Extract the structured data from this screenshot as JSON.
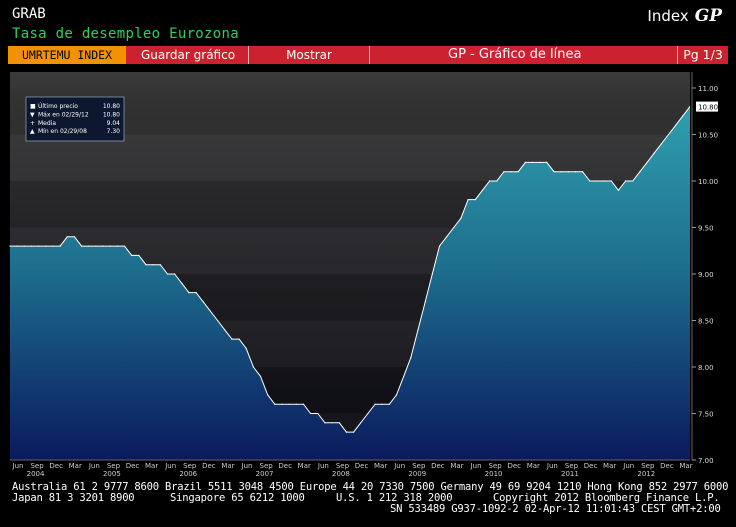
{
  "header": {
    "ticker_short": "GRAB",
    "title": "Tasa de desempleo Eurozona",
    "index_label": "Index",
    "function_code": "GP"
  },
  "menubar": {
    "ticker": "UMRTEMU INDEX",
    "save_label": "Guardar gráfico",
    "show_label": "Mostrar",
    "chart_title": "GP - Gráfico de línea",
    "page": "Pg 1/3"
  },
  "legend": {
    "rows": [
      {
        "label": "Último precio",
        "value": "10.80"
      },
      {
        "label": "Máx en 02/29/12",
        "value": "10.80"
      },
      {
        "label": "Media",
        "value": "9.04"
      },
      {
        "label": "Mín en 02/29/08",
        "value": "7.30"
      }
    ]
  },
  "last_price_tag": "10.80",
  "colors": {
    "accent_orange": "#f29200",
    "menubar_red": "#cc2230",
    "subtitle_green": "#2fd05a",
    "area_teal": "#2a8ea0",
    "area_navy": "#0a1a5e"
  },
  "chart_data": {
    "type": "area",
    "title": "Tasa de desempleo Eurozona",
    "ylim": [
      7.0,
      11.0
    ],
    "y_ticks": [
      "7.00",
      "7.50",
      "8.00",
      "8.50",
      "9.00",
      "9.50",
      "10.00",
      "10.50",
      "11.00"
    ],
    "grid": true,
    "x_start": "2003-06",
    "month_step": 1,
    "month_ticks": [
      "Jun",
      "Sep",
      "Dec",
      "Mar",
      "Jun",
      "Sep",
      "Dec",
      "Mar",
      "Jun",
      "Sep",
      "Dec",
      "Mar",
      "Jun",
      "Sep",
      "Dec",
      "Mar",
      "Jun",
      "Sep",
      "Dec",
      "Mar",
      "Jun",
      "Sep",
      "Dec",
      "Mar",
      "Jun",
      "Sep",
      "Dec",
      "Mar",
      "Jun",
      "Sep",
      "Dec",
      "Mar",
      "Jun",
      "Sep",
      "Dec",
      "Mar"
    ],
    "years": [
      "2004",
      "2005",
      "2006",
      "2007",
      "2008",
      "2009",
      "2010",
      "2011",
      "2012"
    ],
    "values": [
      9.3,
      9.3,
      9.3,
      9.3,
      9.3,
      9.3,
      9.3,
      9.3,
      9.4,
      9.4,
      9.3,
      9.3,
      9.3,
      9.3,
      9.3,
      9.3,
      9.3,
      9.2,
      9.2,
      9.1,
      9.1,
      9.1,
      9.0,
      9.0,
      8.9,
      8.8,
      8.8,
      8.7,
      8.6,
      8.5,
      8.4,
      8.3,
      8.3,
      8.2,
      8.0,
      7.9,
      7.7,
      7.6,
      7.6,
      7.6,
      7.6,
      7.6,
      7.5,
      7.5,
      7.4,
      7.4,
      7.4,
      7.3,
      7.3,
      7.4,
      7.5,
      7.6,
      7.6,
      7.6,
      7.7,
      7.9,
      8.1,
      8.4,
      8.7,
      9.0,
      9.3,
      9.4,
      9.5,
      9.6,
      9.8,
      9.8,
      9.9,
      10.0,
      10.0,
      10.1,
      10.1,
      10.1,
      10.2,
      10.2,
      10.2,
      10.2,
      10.1,
      10.1,
      10.1,
      10.1,
      10.1,
      10.0,
      10.0,
      10.0,
      10.0,
      9.9,
      10.0,
      10.0,
      10.1,
      10.2,
      10.3,
      10.4,
      10.5,
      10.6,
      10.7,
      10.8
    ]
  },
  "footer": {
    "line1": "Australia 61 2 9777 8600 Brazil 5511 3048 4500 Europe 44 20 7330 7500 Germany 49 69 9204 1210 Hong Kong 852 2977 6000",
    "line2a": "Japan 81 3 3201 8900",
    "line2b": "Singapore 65 6212 1000",
    "line2c": "U.S. 1 212 318 2000",
    "line2d": "Copyright 2012 Bloomberg Finance L.P.",
    "line3": "SN 533489 G937-1092-2 02-Apr-12 11:01:43 CEST GMT+2:00"
  }
}
